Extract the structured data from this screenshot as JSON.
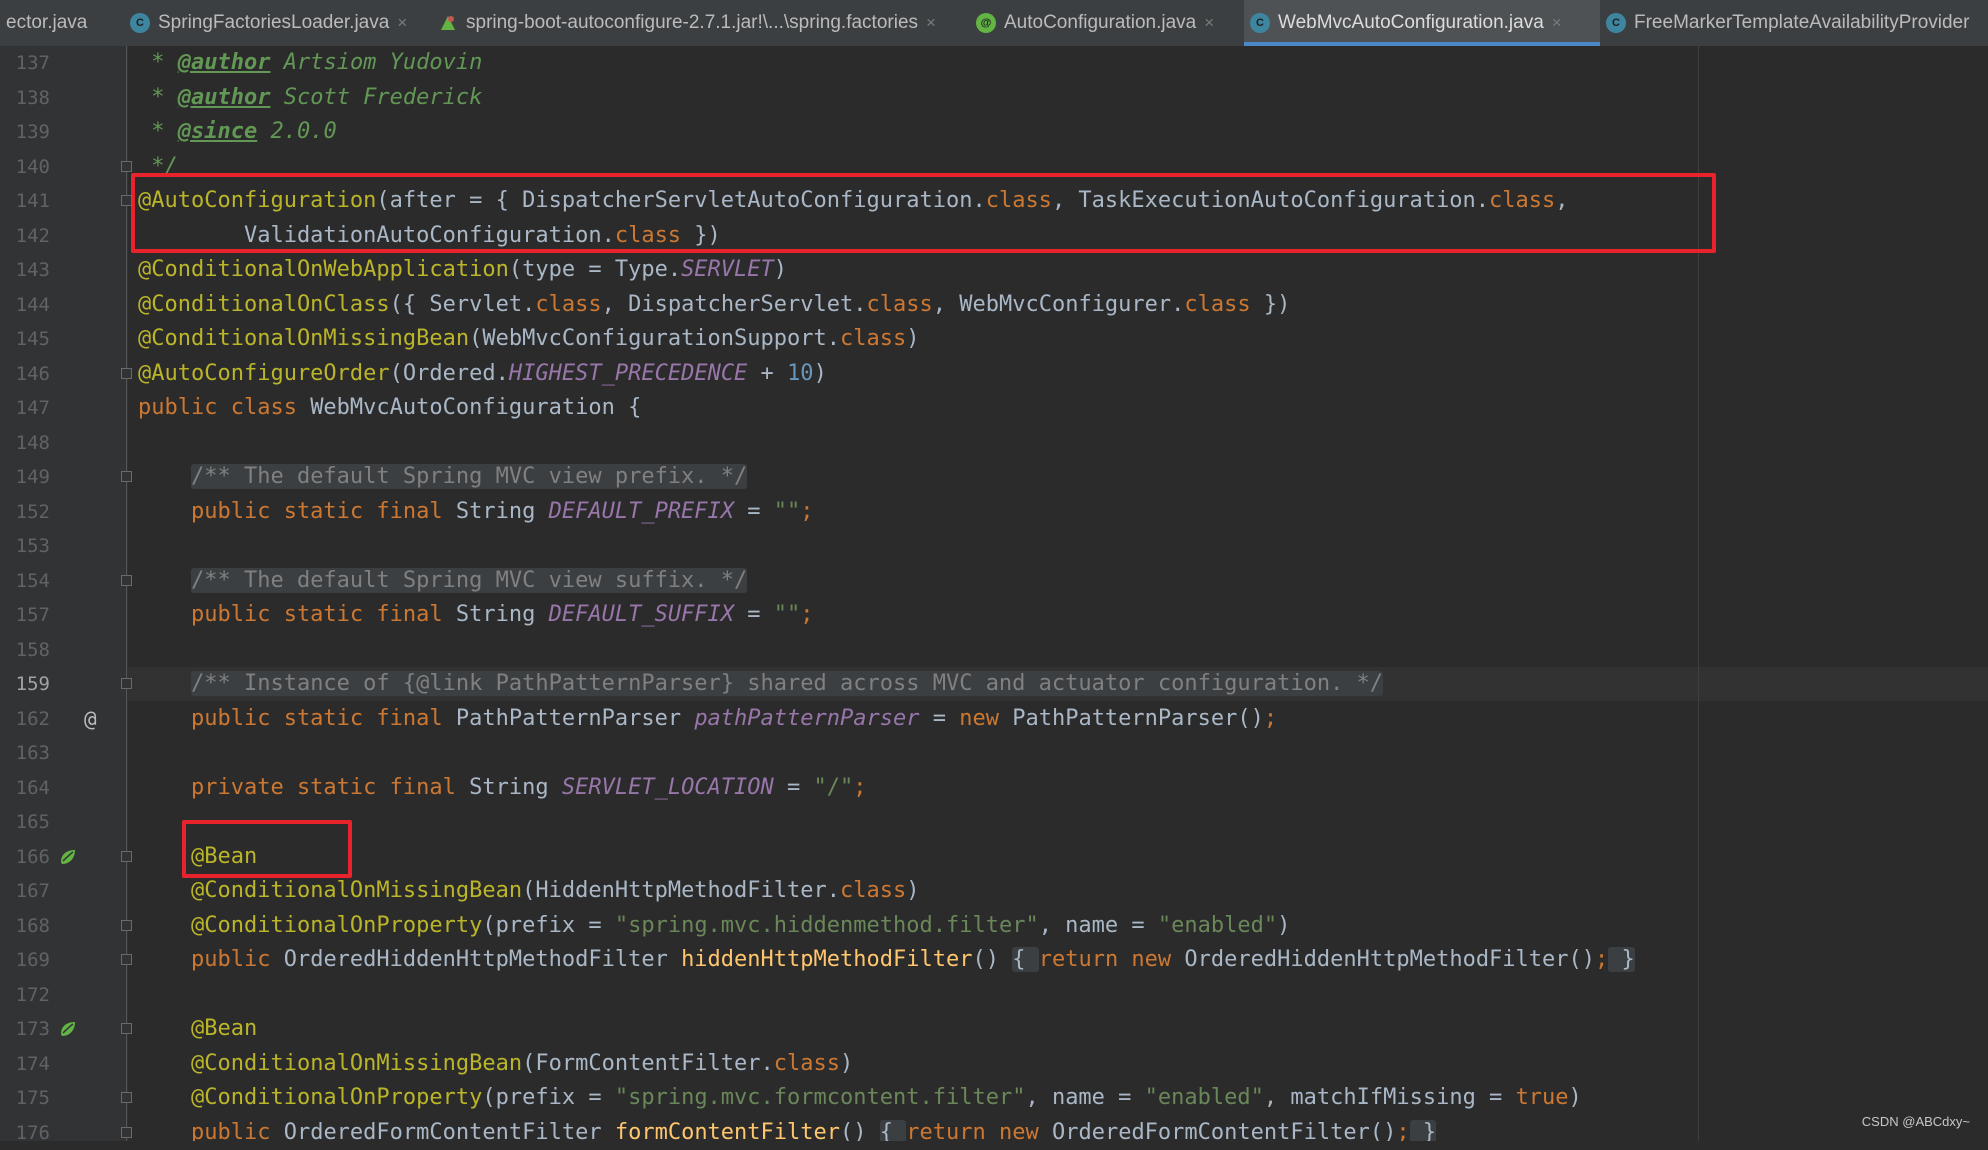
{
  "tabs": [
    {
      "label": "ector.java",
      "icon": "none",
      "active": false,
      "closable": false
    },
    {
      "label": "SpringFactoriesLoader.java",
      "icon": "class-icon",
      "active": false,
      "closable": true
    },
    {
      "label": "spring-boot-autoconfigure-2.7.1.jar!\\...\\spring.factories",
      "icon": "factories-icon",
      "active": false,
      "closable": true
    },
    {
      "label": "AutoConfiguration.java",
      "icon": "annotation-icon",
      "active": false,
      "closable": true
    },
    {
      "label": "WebMvcAutoConfiguration.java",
      "icon": "class-icon",
      "active": true,
      "closable": true
    },
    {
      "label": "FreeMarkerTemplateAvailabilityProvider",
      "icon": "class-icon",
      "active": false,
      "closable": false
    }
  ],
  "editor": {
    "current_line": "159",
    "lines": [
      {
        "num": "137",
        "tokens": [
          [
            "jdoc",
            " * "
          ],
          [
            "jtag",
            "@author"
          ],
          [
            "jdoc",
            " Artsiom Yudovin"
          ]
        ]
      },
      {
        "num": "138",
        "tokens": [
          [
            "jdoc",
            " * "
          ],
          [
            "jtag",
            "@author"
          ],
          [
            "jdoc",
            " Scott Frederick"
          ]
        ]
      },
      {
        "num": "139",
        "tokens": [
          [
            "jdoc",
            " * "
          ],
          [
            "jtag",
            "@since"
          ],
          [
            "jdoc",
            " 2.0.0"
          ]
        ]
      },
      {
        "num": "140",
        "tokens": [
          [
            "jdoc",
            " */"
          ]
        ]
      },
      {
        "num": "141",
        "tokens": [
          [
            "ann",
            "@AutoConfiguration"
          ],
          [
            "plain",
            "(after = { DispatcherServletAutoConfiguration."
          ],
          [
            "kw",
            "class"
          ],
          [
            "plain",
            ", TaskExecutionAutoConfiguration."
          ],
          [
            "kw",
            "class"
          ],
          [
            "plain",
            ","
          ]
        ]
      },
      {
        "num": "142",
        "tokens": [
          [
            "plain",
            "        ValidationAutoConfiguration."
          ],
          [
            "kw",
            "class"
          ],
          [
            "plain",
            " })"
          ]
        ]
      },
      {
        "num": "143",
        "tokens": [
          [
            "ann",
            "@ConditionalOnWebApplication"
          ],
          [
            "plain",
            "(type = Type."
          ],
          [
            "fld",
            "SERVLET"
          ],
          [
            "plain",
            ")"
          ]
        ]
      },
      {
        "num": "144",
        "tokens": [
          [
            "ann",
            "@ConditionalOnClass"
          ],
          [
            "plain",
            "({ Servlet."
          ],
          [
            "kw",
            "class"
          ],
          [
            "plain",
            ", DispatcherServlet."
          ],
          [
            "kw",
            "class"
          ],
          [
            "plain",
            ", WebMvcConfigurer."
          ],
          [
            "kw",
            "class"
          ],
          [
            "plain",
            " })"
          ]
        ]
      },
      {
        "num": "145",
        "tokens": [
          [
            "ann",
            "@ConditionalOnMissingBean"
          ],
          [
            "plain",
            "(WebMvcConfigurationSupport."
          ],
          [
            "kw",
            "class"
          ],
          [
            "plain",
            ")"
          ]
        ]
      },
      {
        "num": "146",
        "tokens": [
          [
            "ann",
            "@AutoConfigureOrder"
          ],
          [
            "plain",
            "(Ordered."
          ],
          [
            "fld",
            "HIGHEST_PRECEDENCE"
          ],
          [
            "plain",
            " + "
          ],
          [
            "num",
            "10"
          ],
          [
            "plain",
            ")"
          ]
        ]
      },
      {
        "num": "147",
        "tokens": [
          [
            "kw",
            "public class "
          ],
          [
            "plain",
            "WebMvcAutoConfiguration {"
          ]
        ]
      },
      {
        "num": "148",
        "tokens": []
      },
      {
        "num": "149",
        "tokens": [
          [
            "plain",
            "    "
          ],
          [
            "cmt-fold",
            "/** The default Spring MVC view prefix. */"
          ]
        ]
      },
      {
        "num": "152",
        "tokens": [
          [
            "kw",
            "    public static final "
          ],
          [
            "plain",
            "String "
          ],
          [
            "fld",
            "DEFAULT_PREFIX"
          ],
          [
            "plain",
            " = "
          ],
          [
            "str",
            "\"\""
          ],
          [
            "kw",
            ";"
          ]
        ]
      },
      {
        "num": "153",
        "tokens": []
      },
      {
        "num": "154",
        "tokens": [
          [
            "plain",
            "    "
          ],
          [
            "cmt-fold",
            "/** The default Spring MVC view suffix. */"
          ]
        ]
      },
      {
        "num": "157",
        "tokens": [
          [
            "kw",
            "    public static final "
          ],
          [
            "plain",
            "String "
          ],
          [
            "fld",
            "DEFAULT_SUFFIX"
          ],
          [
            "plain",
            " = "
          ],
          [
            "str",
            "\"\""
          ],
          [
            "kw",
            ";"
          ]
        ]
      },
      {
        "num": "158",
        "tokens": []
      },
      {
        "num": "159",
        "tokens": [
          [
            "plain",
            "    "
          ],
          [
            "cmt-fold",
            "/** Instance of {@link PathPatternParser} shared across MVC and actuator configuration. */"
          ]
        ]
      },
      {
        "num": "162",
        "tokens": [
          [
            "kw",
            "    public static final "
          ],
          [
            "plain",
            "PathPatternParser "
          ],
          [
            "fld",
            "pathPatternParser"
          ],
          [
            "plain",
            " = "
          ],
          [
            "kw",
            "new "
          ],
          [
            "plain",
            "PathPatternParser()"
          ],
          [
            "kw",
            ";"
          ]
        ]
      },
      {
        "num": "163",
        "tokens": []
      },
      {
        "num": "164",
        "tokens": [
          [
            "kw",
            "    private static final "
          ],
          [
            "plain",
            "String "
          ],
          [
            "fld",
            "SERVLET_LOCATION"
          ],
          [
            "plain",
            " = "
          ],
          [
            "str",
            "\"/\""
          ],
          [
            "kw",
            ";"
          ]
        ]
      },
      {
        "num": "165",
        "tokens": []
      },
      {
        "num": "166",
        "tokens": [
          [
            "plain",
            "    "
          ],
          [
            "ann",
            "@Bean"
          ]
        ]
      },
      {
        "num": "167",
        "tokens": [
          [
            "plain",
            "    "
          ],
          [
            "ann",
            "@ConditionalOnMissingBean"
          ],
          [
            "plain",
            "(HiddenHttpMethodFilter."
          ],
          [
            "kw",
            "class"
          ],
          [
            "plain",
            ")"
          ]
        ]
      },
      {
        "num": "168",
        "tokens": [
          [
            "plain",
            "    "
          ],
          [
            "ann",
            "@ConditionalOnProperty"
          ],
          [
            "plain",
            "(prefix = "
          ],
          [
            "str",
            "\"spring.mvc.hiddenmethod.filter\""
          ],
          [
            "plain",
            ", name = "
          ],
          [
            "str",
            "\"enabled\""
          ],
          [
            "plain",
            ")"
          ]
        ]
      },
      {
        "num": "169",
        "tokens": [
          [
            "kw",
            "    public "
          ],
          [
            "plain",
            "OrderedHiddenHttpMethodFilter "
          ],
          [
            "fn",
            "hiddenHttpMethodFilter"
          ],
          [
            "plain",
            "() "
          ],
          [
            "fold",
            "{ "
          ],
          [
            "kw",
            "return new "
          ],
          [
            "plain",
            "OrderedHiddenHttpMethodFilter()"
          ],
          [
            "kw",
            ";"
          ],
          [
            "fold",
            " }"
          ]
        ]
      },
      {
        "num": "172",
        "tokens": []
      },
      {
        "num": "173",
        "tokens": [
          [
            "plain",
            "    "
          ],
          [
            "ann",
            "@Bean"
          ]
        ]
      },
      {
        "num": "174",
        "tokens": [
          [
            "plain",
            "    "
          ],
          [
            "ann",
            "@ConditionalOnMissingBean"
          ],
          [
            "plain",
            "(FormContentFilter."
          ],
          [
            "kw",
            "class"
          ],
          [
            "plain",
            ")"
          ]
        ]
      },
      {
        "num": "175",
        "tokens": [
          [
            "plain",
            "    "
          ],
          [
            "ann",
            "@ConditionalOnProperty"
          ],
          [
            "plain",
            "(prefix = "
          ],
          [
            "str",
            "\"spring.mvc.formcontent.filter\""
          ],
          [
            "plain",
            ", name = "
          ],
          [
            "str",
            "\"enabled\""
          ],
          [
            "plain",
            ", matchIfMissing = "
          ],
          [
            "kw",
            "true"
          ],
          [
            "plain",
            ")"
          ]
        ]
      },
      {
        "num": "176",
        "tokens": [
          [
            "kw",
            "    public "
          ],
          [
            "plain",
            "OrderedFormContentFilter "
          ],
          [
            "fn",
            "formContentFilter"
          ],
          [
            "plain",
            "() "
          ],
          [
            "fold",
            "{ "
          ],
          [
            "kw",
            "return new "
          ],
          [
            "plain",
            "OrderedFormContentFilter()"
          ],
          [
            "kw",
            ";"
          ],
          [
            "fold",
            " }"
          ]
        ]
      }
    ],
    "fold_markers_on": [
      "140",
      "141",
      "146",
      "149",
      "154",
      "159",
      "166",
      "168",
      "169",
      "173",
      "175",
      "176"
    ],
    "gutter_at_on": "162",
    "bean_icons_on": [
      "166",
      "173"
    ]
  },
  "watermark": "CSDN @ABCdxy~",
  "colors": {
    "background": "#2b2b2b",
    "annotation": "#bbb529",
    "keyword": "#cc7832",
    "string": "#6a8759",
    "highlight_box": "#e8232b",
    "active_tab_underline": "#4a88c7"
  }
}
